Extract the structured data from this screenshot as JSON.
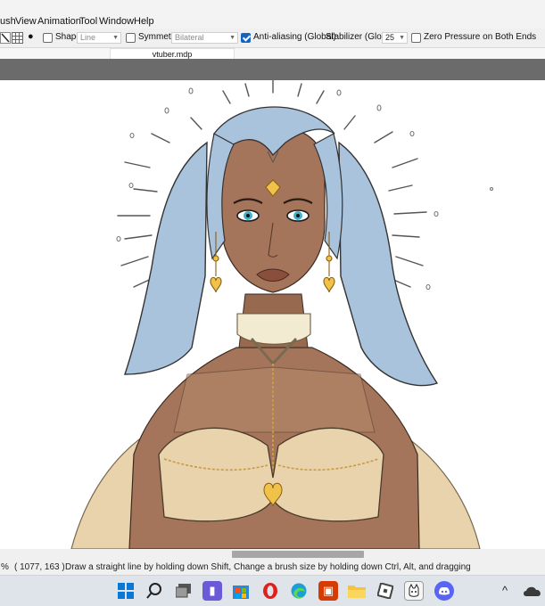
{
  "menu": {
    "brush": "ush",
    "view": "View",
    "animation": "Animation",
    "tool": "Tool",
    "window": "Window",
    "help": "Help"
  },
  "toolbar": {
    "shape_label": "Shape",
    "shape_value": "Line",
    "symmetry_label": "Symmetry",
    "symmetry_value": "Bilateral",
    "antialias_label": "Anti-aliasing (Global)",
    "antialias_checked": true,
    "stabilizer_label": "Stabilizer (Global)",
    "stabilizer_value": "25",
    "zero_pressure_label": "Zero Pressure on Both Ends"
  },
  "document": {
    "tab_title": "vtuber.mdp"
  },
  "status": {
    "zoom": "%",
    "coords": "( 1077, 163 )",
    "hint": "Draw a straight line by holding down Shift, Change a brush size by holding down Ctrl, Alt, and dragging"
  },
  "taskbar": {
    "icons": [
      "windows-start-icon",
      "search-icon",
      "task-view-icon",
      "teams-chat-icon",
      "store-icon",
      "opera-icon",
      "edge-icon",
      "office-icon",
      "file-explorer-icon",
      "roblox-icon",
      "medibang-icon",
      "discord-icon"
    ],
    "tray_chevron": "^"
  },
  "colors": {
    "accent": "#1565c0",
    "hair": "#a9c3dc",
    "skin": "#a5755b",
    "gold": "#d6b27a",
    "dress": "#e8d3ad",
    "canvas_header": "#6b6b6b"
  }
}
